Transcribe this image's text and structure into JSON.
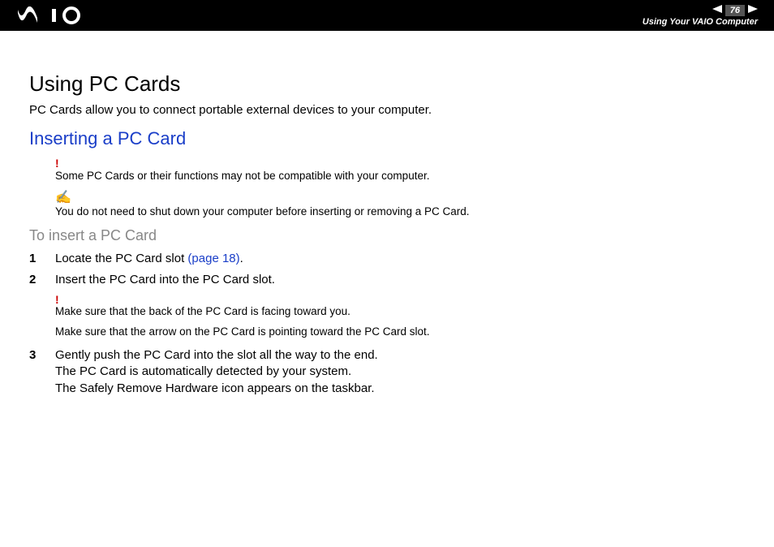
{
  "header": {
    "page_number": "76",
    "section": "Using Your VAIO Computer"
  },
  "content": {
    "h1": "Using PC Cards",
    "intro": "PC Cards allow you to connect portable external devices to your computer.",
    "h2": "Inserting a PC Card",
    "note1": "Some PC Cards or their functions may not be compatible with your computer.",
    "note2": "You do not need to shut down your computer before inserting or removing a PC Card.",
    "h3": "To insert a PC Card",
    "steps": {
      "s1": {
        "num": "1",
        "text_before": "Locate the PC Card slot ",
        "link": "(page 18)",
        "text_after": "."
      },
      "s2": {
        "num": "2",
        "text": "Insert the PC Card into the PC Card slot."
      },
      "s2_note_a": "Make sure that the back of the PC Card is facing toward you.",
      "s2_note_b": "Make sure that the arrow on the PC Card is pointing toward the PC Card slot.",
      "s3": {
        "num": "3",
        "line1": "Gently push the PC Card into the slot all the way to the end.",
        "line2": "The PC Card is automatically detected by your system.",
        "line3": "The Safely Remove Hardware icon appears on the taskbar."
      }
    }
  }
}
